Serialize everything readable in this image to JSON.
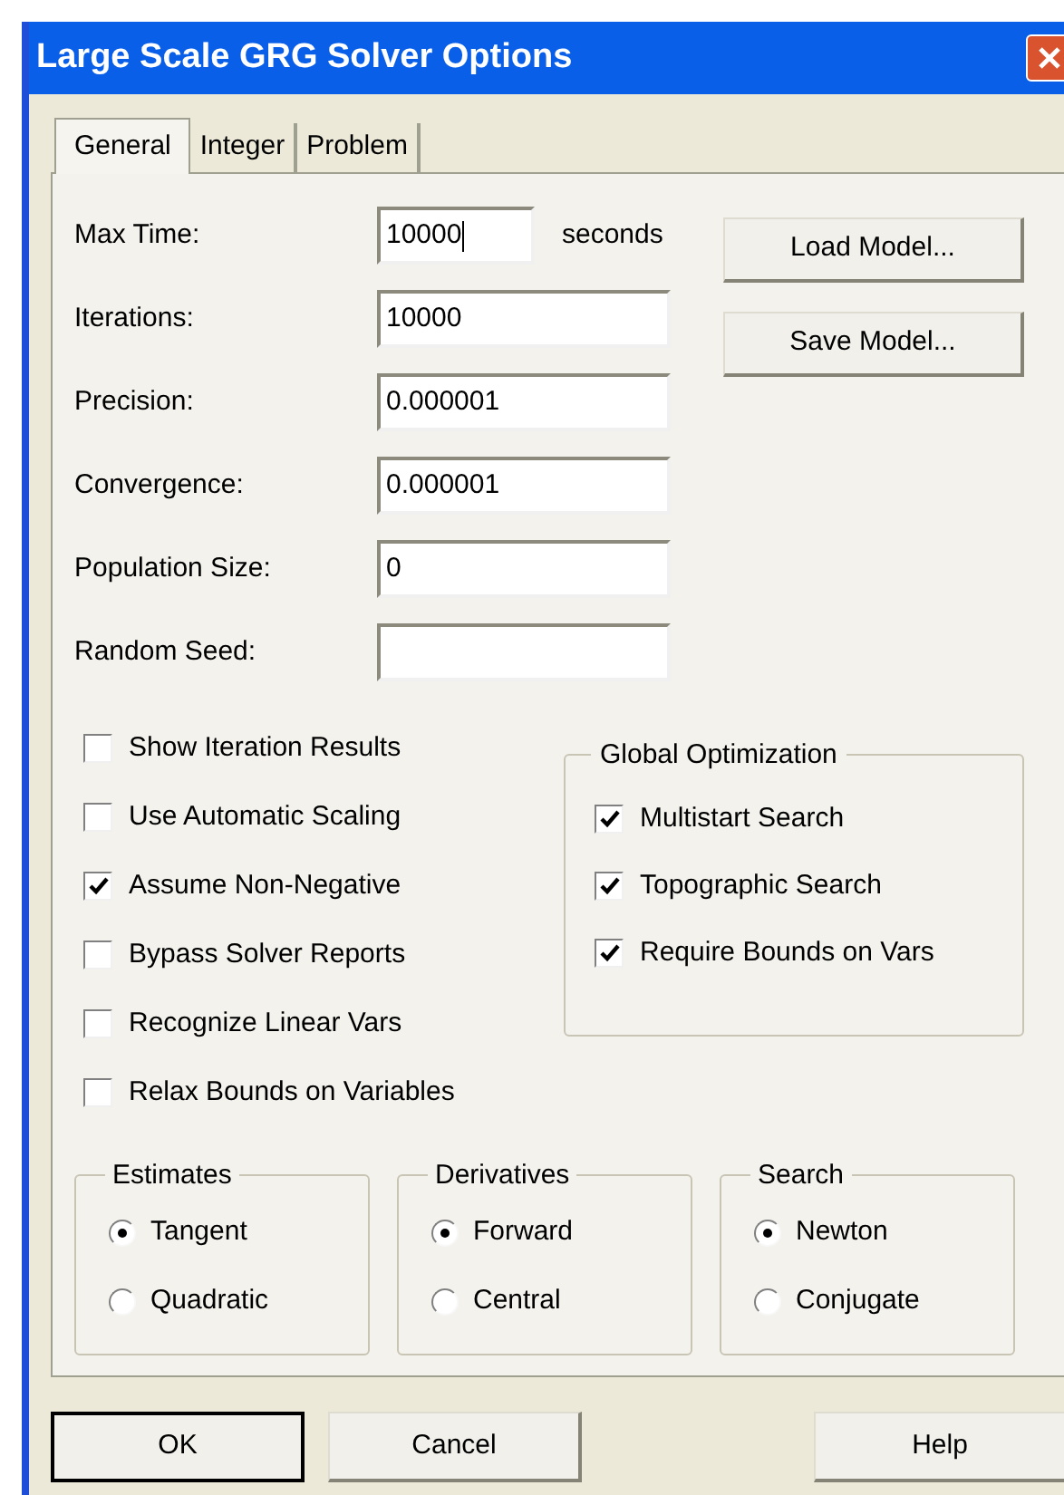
{
  "window": {
    "title": "Large Scale GRG Solver Options"
  },
  "tabs": [
    {
      "label": "General",
      "selected": true
    },
    {
      "label": "Integer",
      "selected": false
    },
    {
      "label": "Problem",
      "selected": false
    }
  ],
  "fields": [
    {
      "label": "Max Time:",
      "value": "10000",
      "suffix": "seconds",
      "focused": true
    },
    {
      "label": "Iterations:",
      "value": "10000",
      "focused": false
    },
    {
      "label": "Precision:",
      "value": "0.000001",
      "focused": false
    },
    {
      "label": "Convergence:",
      "value": "0.000001",
      "focused": false
    },
    {
      "label": "Population Size:",
      "value": "0",
      "focused": false
    },
    {
      "label": "Random Seed:",
      "focused": false
    }
  ],
  "side_buttons": [
    "Load Model...",
    "Save Model..."
  ],
  "options": [
    {
      "label": "Show Iteration Results",
      "checked": false
    },
    {
      "label": "Use Automatic Scaling",
      "checked": false
    },
    {
      "label": "Assume Non-Negative",
      "checked": true
    },
    {
      "label": "Bypass Solver Reports",
      "checked": false
    },
    {
      "label": "Recognize Linear Vars",
      "checked": false
    },
    {
      "label": "Relax Bounds on Variables",
      "checked": false
    }
  ],
  "global_optimization": {
    "title": "Global Optimization",
    "options": [
      {
        "label": "Multistart Search",
        "checked": true
      },
      {
        "label": "Topographic Search",
        "checked": true
      },
      {
        "label": "Require Bounds on Vars",
        "checked": true
      }
    ]
  },
  "radio_groups": [
    {
      "title": "Estimates",
      "options": [
        {
          "label": "Tangent",
          "selected": true
        },
        {
          "label": "Quadratic",
          "selected": false
        }
      ]
    },
    {
      "title": "Derivatives",
      "options": [
        {
          "label": "Forward",
          "selected": true
        },
        {
          "label": "Central",
          "selected": false
        }
      ]
    },
    {
      "title": "Search",
      "options": [
        {
          "label": "Newton",
          "selected": true
        },
        {
          "label": "Conjugate",
          "selected": false
        }
      ]
    }
  ],
  "buttons": [
    {
      "label": "OK",
      "default": true
    },
    {
      "label": "Cancel",
      "default": false
    },
    {
      "label": "Help",
      "default": false
    }
  ]
}
